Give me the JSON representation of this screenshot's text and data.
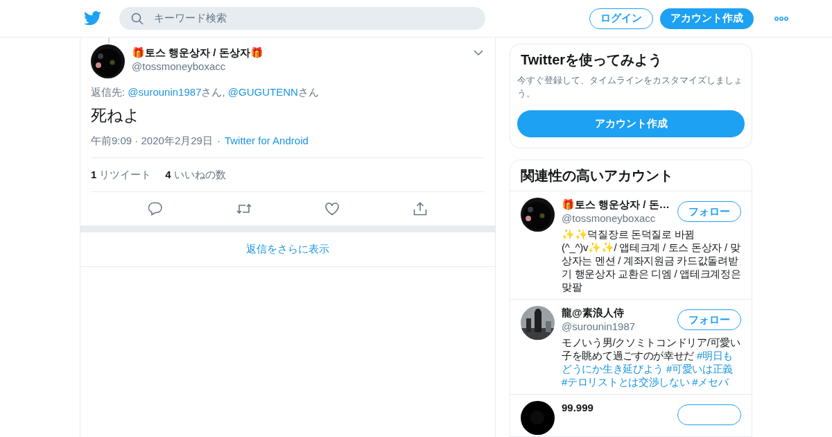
{
  "header": {
    "search_placeholder": "キーワード検索",
    "login": "ログイン",
    "signup": "アカウント作成"
  },
  "tweet": {
    "name": "🎁토스 행운상자 / 돈상자🎁",
    "handle": "@tossmoneyboxacc",
    "reply_to": [
      {
        "kind": "text",
        "text": "返信先: "
      },
      {
        "kind": "link",
        "text": "@surounin1987"
      },
      {
        "kind": "text",
        "text": "さん, "
      },
      {
        "kind": "link",
        "text": "@GUGUTENN"
      },
      {
        "kind": "text",
        "text": "さん"
      }
    ],
    "text": "死ねよ",
    "time": "午前9:09 · 2020年2月29日",
    "separator": "·",
    "source": "Twitter for Android",
    "stats": [
      {
        "count": "1",
        "label": "リツイート"
      },
      {
        "count": "4",
        "label": "いいねの数"
      }
    ]
  },
  "more_replies": "返信をさらに表示",
  "signup_card": {
    "title": "Twitterを使ってみよう",
    "text": "今すぐ登録して、タイムラインをカスタマイズしましょう。",
    "button": "アカウント作成"
  },
  "related": {
    "title": "関連性の高いアカウント",
    "accounts": [
      {
        "name": "🎁토스 행운상자 / 돈…",
        "handle": "@tossmoneyboxacc",
        "follow": "フォロー",
        "bio": [
          {
            "kind": "text",
            "text": "✨✨덕질장르 돈덕질로 바뀜(^_^)v✨✨/ 앱테크계 / 토스 돈상자 / 맞상자는 멘션 / 계좌지원금 카드값돌려받기 행운상자 교환은 디엠 / 앱테크계정은 맞팔"
          }
        ]
      },
      {
        "name": "龍@素浪人侍",
        "handle": "@surounin1987",
        "follow": "フォロー",
        "bio": [
          {
            "kind": "text",
            "text": "モノいう男/クソミトコンドリア/可愛い子を眺めて過ごすのが幸せだ "
          },
          {
            "kind": "tag",
            "text": "#明日もどうにか生き延びよう"
          },
          {
            "kind": "tag",
            "text": "#可愛いは正義"
          },
          {
            "kind": "tag",
            "text": "#テロリストとは交渉しない"
          },
          {
            "kind": "tag",
            "text": "#メセバ"
          }
        ]
      },
      {
        "name": "99.999"
      }
    ]
  }
}
